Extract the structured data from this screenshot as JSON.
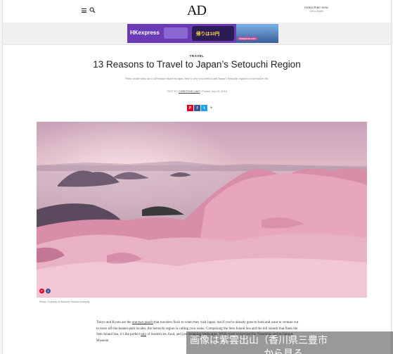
{
  "header": {
    "logo": "AD",
    "subscribe_line1": "SUBSCRIBE NOW",
    "subscribe_line2": "Gift a Digital"
  },
  "ad": {
    "brand": "HKexpress",
    "promo": "帰りは10円",
    "url": "hkexpress.com"
  },
  "article": {
    "kicker": "TRAVEL",
    "title": "13 Reasons to Travel to Japan’s Setouchi Region",
    "dek": "From world-class art to all-season island escapes, here is why you need to add Japan’s Setouchi region to your bucket list",
    "byline_prefix": "TEXT BY",
    "author": "CHRISTINE LIAO",
    "byline_sep": "|",
    "posted": "Posted July 29, 2018",
    "share": {
      "pinterest": "P",
      "facebook": "f",
      "twitter": "t",
      "more": "+"
    },
    "hero_share": {
      "pinterest": "P",
      "facebook": "f"
    },
    "photo_credit": "Photo: Courtesy of Setouchi Tourism Authority",
    "body": [
      "Tokyo and Kyoto are the ",
      "one-two punch",
      " that travelers flock to when they visit Japan, but if you've already gone to both and want to venture out to more off-the-beaten-path locales, the Setouchi region is calling your name. Comprising the Seto Inland Sea and the hill islands that flank the Seto Inland Sea, it's the perfect ",
      "mix",
      " of modern art, food, and jaw-dropping landscapes. While most recognized for Naoshima and its famous Museum"
    ]
  },
  "overlay": {
    "line1": "画像は紫雲出山（香川県三豊市",
    "line2": "から見る"
  }
}
